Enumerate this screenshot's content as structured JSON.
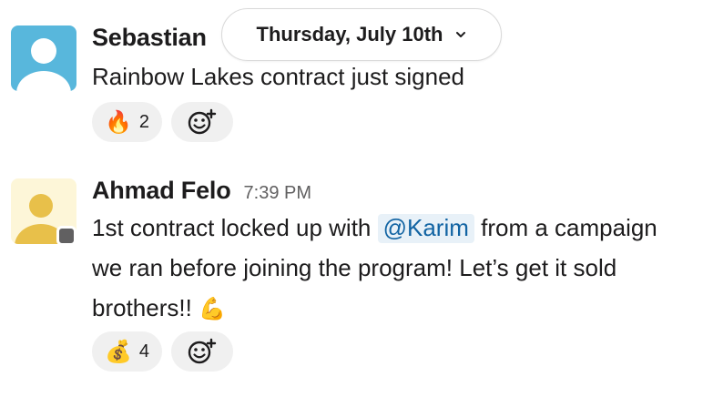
{
  "date_divider": {
    "label": "Thursday, July 10th"
  },
  "messages": [
    {
      "author": "Sebastian",
      "time": "",
      "text": "Rainbow Lakes contract just signed",
      "reactions": [
        {
          "emoji": "🔥",
          "count": "2"
        }
      ]
    },
    {
      "author": "Ahmad Felo",
      "time": "7:39 PM",
      "text_before": "1st contract locked up with ",
      "mention": "@Karim",
      "text_after": " from a campaign we ran before joining the program! Let’s get it sold brothers!! ",
      "text_emoji": "💪",
      "reactions": [
        {
          "emoji": "💰",
          "count": "4"
        }
      ]
    }
  ],
  "colors": {
    "mention_text": "#1264a3",
    "mention_bg": "#e8f1f8",
    "avatar1_bg": "#58b7dc",
    "avatar2_bg": "#fdf6d8",
    "avatar2_figure": "#e8c04a",
    "status_badge": "#616061"
  },
  "icons": {
    "add_reaction": "add-reaction-icon",
    "chevron": "chevron-down-icon"
  }
}
